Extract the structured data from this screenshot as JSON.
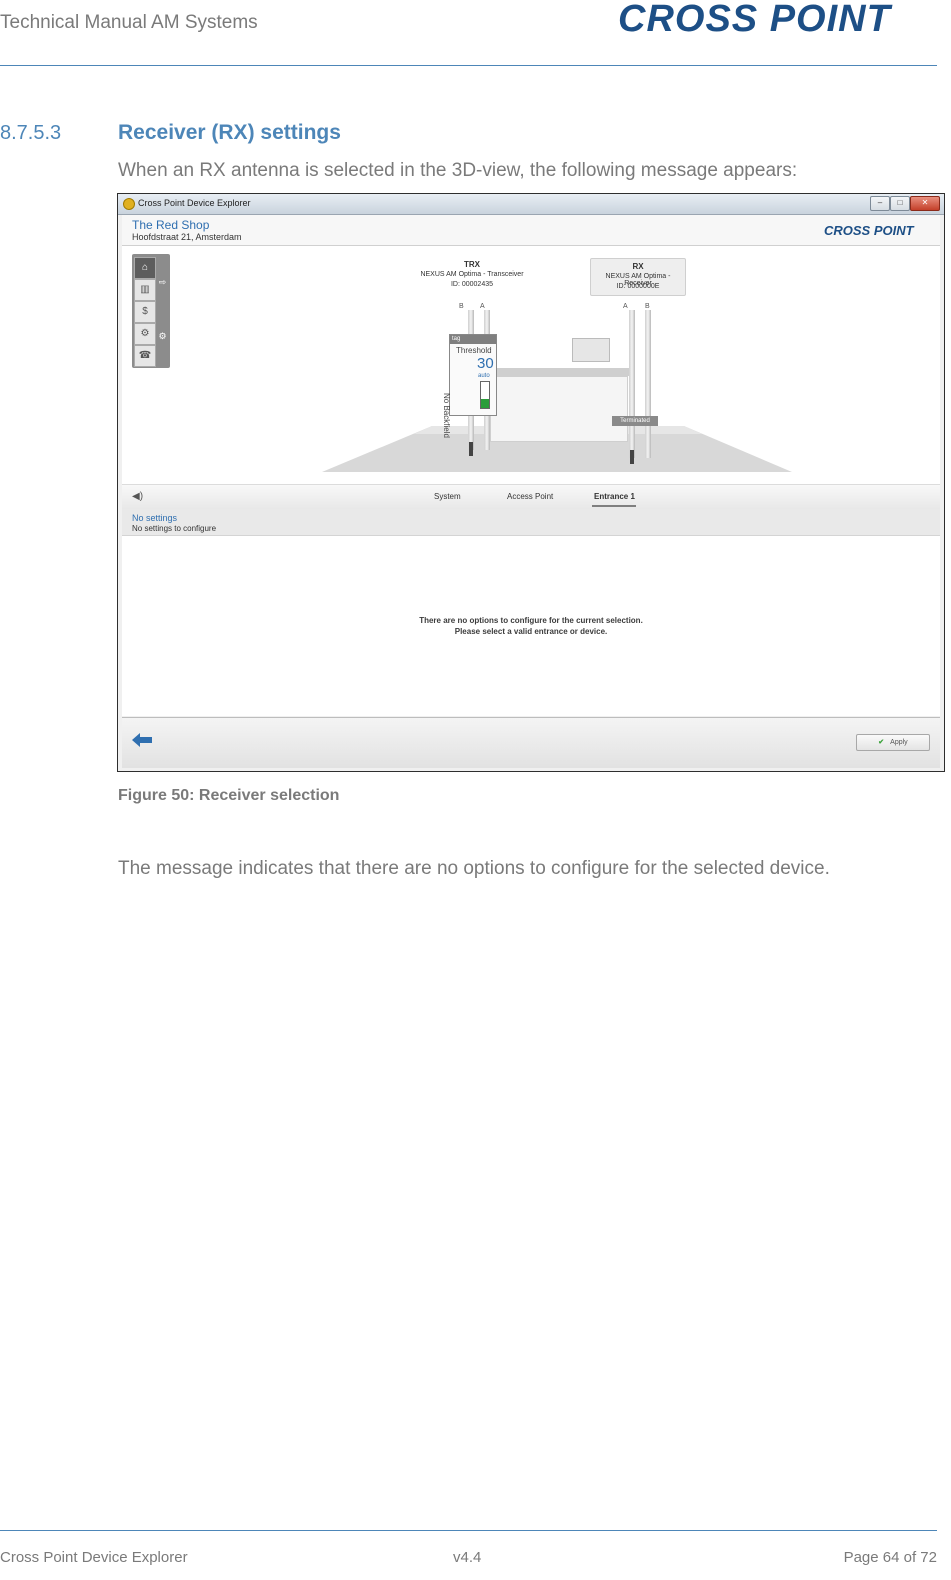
{
  "header": {
    "doc_title": "Technical Manual AM Systems",
    "logo_text": "CROSS POINT"
  },
  "section": {
    "number": "8.7.5.3",
    "title": "Receiver (RX) settings",
    "intro": "When an RX antenna is selected in the 3D-view, the following message appears:"
  },
  "screenshot": {
    "window_title": "Cross Point Device Explorer",
    "shop_name": "The Red Shop",
    "shop_address": "Hoofdstraat 21, Amsterdam",
    "logo_text": "CROSS POINT",
    "trx": {
      "title": "TRX",
      "model": "NEXUS AM Optima - Transceiver",
      "id": "ID: 00002435"
    },
    "rx": {
      "title": "RX",
      "model": "NEXUS AM Optima - Receiver",
      "id": "ID: 0000000E"
    },
    "antenna_labels": {
      "left_b": "B",
      "left_a": "A",
      "right_a": "A",
      "right_b": "B"
    },
    "threshold_panel": {
      "header": "tag",
      "title": "Threshold",
      "value": "30",
      "mode": "auto",
      "status": "No Backfield",
      "level_fraction": 0.35
    },
    "terminated_label": "Terminated",
    "tabs": [
      {
        "label": "System"
      },
      {
        "label": "Access Point"
      },
      {
        "label": "Entrance 1"
      }
    ],
    "settings": {
      "title": "No settings",
      "subtitle": "No settings to configure"
    },
    "message": {
      "line1": "There are no options to configure for the current selection.",
      "line2": "Please select a valid entrance or device."
    },
    "apply_label": "Apply",
    "colors": {
      "accent_blue": "#2f6fb0",
      "status_green": "#2a9d3a"
    }
  },
  "caption": "Figure 50: Receiver selection",
  "body": "The message indicates that there are no options to configure for the selected device.",
  "footer": {
    "left": "Cross Point Device Explorer",
    "center": "v4.4",
    "right": "Page 64 of 72"
  }
}
